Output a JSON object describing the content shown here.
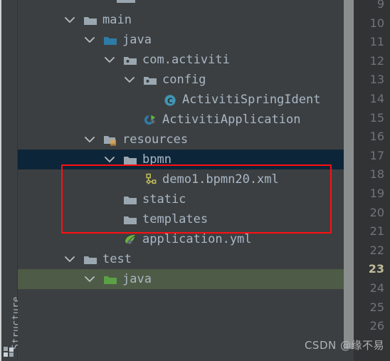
{
  "app": {
    "theme_bg": "#3c3f41",
    "selection_color": "#0d2538",
    "highlight_color": "#4e5b46",
    "annotation_color": "#ff0f12",
    "text_color": "#a9b7c6"
  },
  "toolstrip": {
    "label": "Structure",
    "icon": "structure-icon"
  },
  "project_tree": {
    "rows": [
      {
        "label": "main",
        "icon": "folder-icon",
        "indent": 0,
        "expanded": true,
        "has_chevron": true,
        "selected": false,
        "highlight": false,
        "icon_color": "#9aa7b0"
      },
      {
        "label": "java",
        "icon": "folder-source-icon",
        "indent": 1,
        "expanded": true,
        "has_chevron": true,
        "selected": false,
        "highlight": false,
        "icon_color": "#2e7ba6"
      },
      {
        "label": "com.activiti",
        "icon": "package-icon",
        "indent": 2,
        "expanded": true,
        "has_chevron": true,
        "selected": false,
        "highlight": false,
        "icon_color": "#9aa7b0"
      },
      {
        "label": "config",
        "icon": "package-icon",
        "indent": 3,
        "expanded": true,
        "has_chevron": true,
        "selected": false,
        "highlight": false,
        "icon_color": "#9aa7b0"
      },
      {
        "label": "ActivitiSpringIdent",
        "icon": "java-class-icon",
        "indent": 4,
        "expanded": false,
        "has_chevron": false,
        "selected": false,
        "highlight": false,
        "icon_color": "#3f96b4"
      },
      {
        "label": "ActivitiApplication",
        "icon": "spring-boot-class-icon",
        "indent": 3,
        "expanded": false,
        "has_chevron": false,
        "selected": false,
        "highlight": false,
        "icon_color": "#2e7ba6"
      },
      {
        "label": "resources",
        "icon": "folder-resources-icon",
        "indent": 1,
        "expanded": true,
        "has_chevron": true,
        "selected": false,
        "highlight": false,
        "icon_color": "#9aa7b0"
      },
      {
        "label": "bpmn",
        "icon": "folder-icon",
        "indent": 2,
        "expanded": true,
        "has_chevron": true,
        "selected": true,
        "highlight": false,
        "icon_color": "#9aa7b0"
      },
      {
        "label": "demo1.bpmn20.xml",
        "icon": "bpmn-file-icon",
        "indent": 3,
        "expanded": false,
        "has_chevron": false,
        "selected": false,
        "highlight": false,
        "icon_color": "#c0bc5a"
      },
      {
        "label": "static",
        "icon": "folder-icon",
        "indent": 2,
        "expanded": false,
        "has_chevron": false,
        "selected": false,
        "highlight": false,
        "icon_color": "#9aa7b0"
      },
      {
        "label": "templates",
        "icon": "folder-icon",
        "indent": 2,
        "expanded": false,
        "has_chevron": false,
        "selected": false,
        "highlight": false,
        "icon_color": "#9aa7b0"
      },
      {
        "label": "application.yml",
        "icon": "spring-config-file-icon",
        "indent": 2,
        "expanded": false,
        "has_chevron": false,
        "selected": false,
        "highlight": false,
        "icon_color": "#6db33f"
      },
      {
        "label": "test",
        "icon": "folder-icon",
        "indent": 0,
        "expanded": true,
        "has_chevron": true,
        "selected": false,
        "highlight": false,
        "icon_color": "#9aa7b0"
      },
      {
        "label": "java",
        "icon": "folder-test-source-icon",
        "indent": 1,
        "expanded": true,
        "has_chevron": true,
        "selected": false,
        "highlight": true,
        "icon_color": "#5ba046"
      }
    ]
  },
  "editor_gutter": {
    "line_numbers": [
      "9",
      "10",
      "11",
      "12",
      "13",
      "14",
      "15",
      "16",
      "17",
      "18",
      "19",
      "20",
      "21",
      "22",
      "23",
      "24",
      "25",
      "26"
    ],
    "active_line": "23"
  },
  "annotation": {
    "shape": "rectangle",
    "color": "#ff0f12",
    "encloses": [
      "resources",
      "bpmn",
      "demo1.bpmn20.xml"
    ]
  },
  "watermark": {
    "text": "CSDN @缘不易"
  }
}
